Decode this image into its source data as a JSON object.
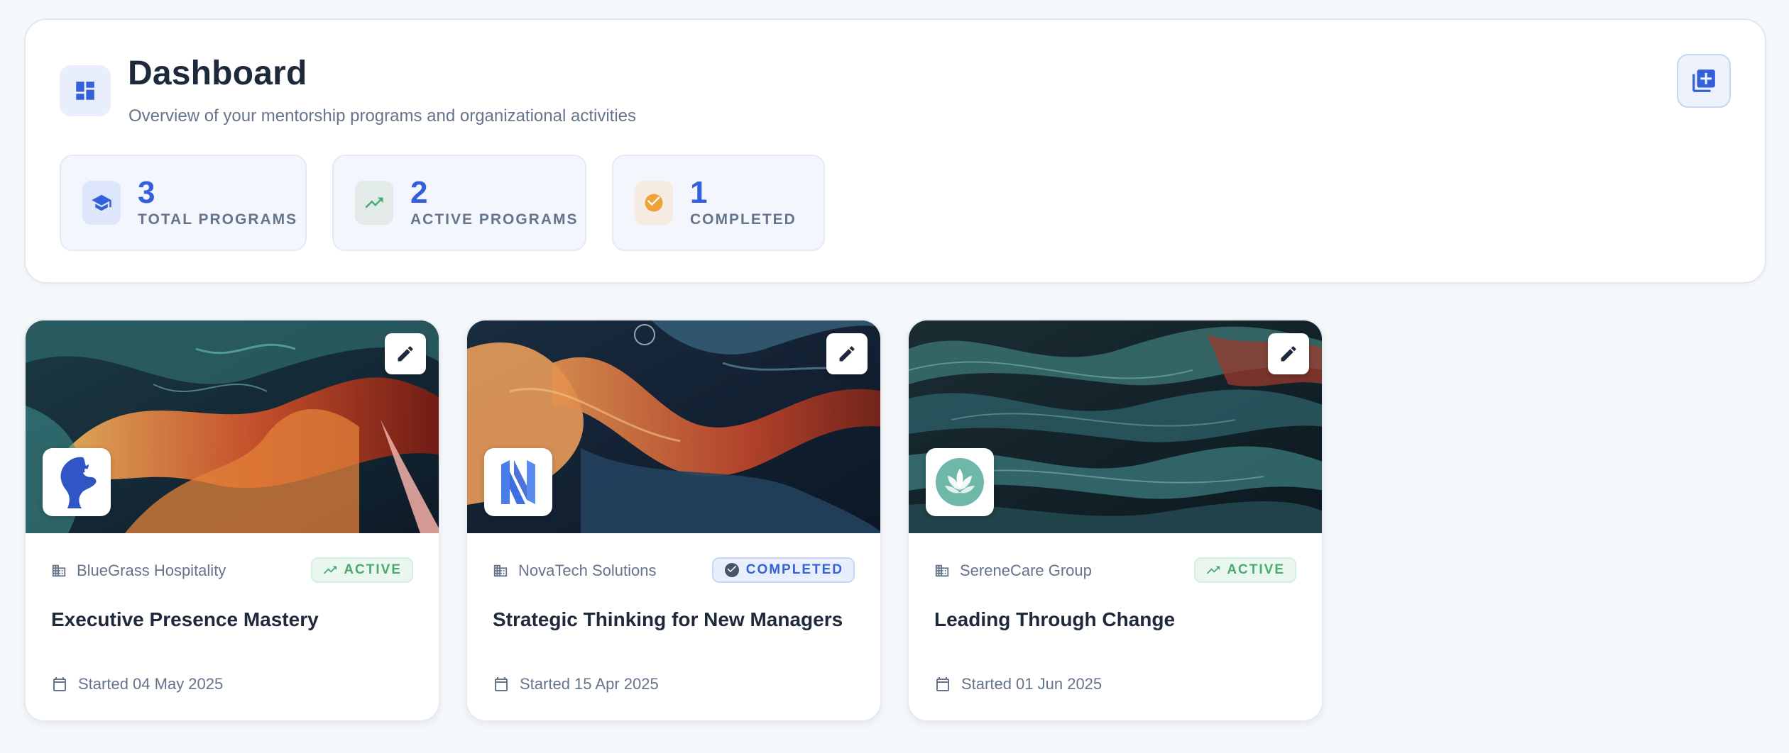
{
  "header": {
    "title": "Dashboard",
    "subtitle": "Overview of your mentorship programs and organizational activities",
    "icon": "dashboard-icon",
    "add_button_icon": "add-box-icon"
  },
  "stats": [
    {
      "value": "3",
      "label": "TOTAL PROGRAMS",
      "icon": "graduation-cap-icon",
      "color": "#3461d9"
    },
    {
      "value": "2",
      "label": "ACTIVE PROGRAMS",
      "icon": "trending-up-icon",
      "color": "#4aaa72"
    },
    {
      "value": "1",
      "label": "COMPLETED",
      "icon": "check-circle-icon",
      "color": "#f0a23a"
    }
  ],
  "programs": [
    {
      "organization": "BlueGrass Hospitality",
      "status": "ACTIVE",
      "title": "Executive Presence Mastery",
      "date": "Started 04 May 2025",
      "logo": "horse-logo"
    },
    {
      "organization": "NovaTech Solutions",
      "status": "COMPLETED",
      "title": "Strategic Thinking for New Managers",
      "date": "Started 15 Apr 2025",
      "logo": "n-letter-logo"
    },
    {
      "organization": "SereneCare Group",
      "status": "ACTIVE",
      "title": "Leading Through Change",
      "date": "Started 01 Jun 2025",
      "logo": "lotus-logo"
    }
  ],
  "colors": {
    "accent": "#3461d9",
    "active_green": "#4aaa72",
    "completed_orange": "#f0a23a",
    "muted_text": "#64748b"
  }
}
